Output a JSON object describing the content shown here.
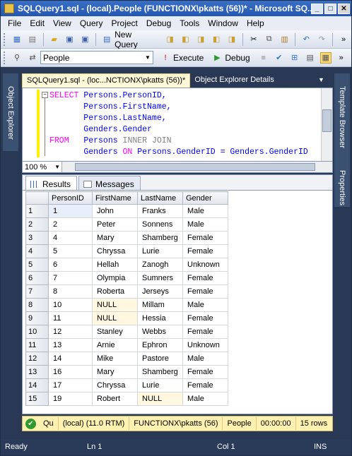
{
  "window": {
    "title": "SQLQuery1.sql - (local).People (FUNCTIONX\\pkatts (56))* - Microsoft SQ..."
  },
  "menu": [
    "File",
    "Edit",
    "View",
    "Query",
    "Project",
    "Debug",
    "Tools",
    "Window",
    "Help"
  ],
  "toolbar1": {
    "new_query_label": "New Query"
  },
  "toolbar2": {
    "database": "People",
    "execute_label": "Execute",
    "debug_label": "Debug"
  },
  "side_tabs": {
    "left": "Object Explorer",
    "right_top": "Template Browser",
    "right_bottom": "Properties"
  },
  "doc_tabs": [
    {
      "label": "SQLQuery1.sql - (loc...NCTIONX\\pkatts (56))*",
      "active": true
    },
    {
      "label": "Object Explorer Details",
      "active": false
    }
  ],
  "sql": {
    "l1": {
      "kw": "SELECT",
      "text": " Persons.PersonID,"
    },
    "l2": {
      "text": "       Persons.FirstName,"
    },
    "l3": {
      "text": "       Persons.LastName,"
    },
    "l4": {
      "text": "       Genders.Gender"
    },
    "l5": {
      "kw": "FROM",
      "pad": "   ",
      "t1": "Persons ",
      "kw2": "INNER JOIN"
    },
    "l6": {
      "pad": "       ",
      "t1": "Genders ",
      "kw": "ON",
      "t2": " Persons.GenderID = Genders.GenderID"
    }
  },
  "zoom": "100 %",
  "result_tabs": {
    "results": "Results",
    "messages": "Messages"
  },
  "grid": {
    "columns": [
      "PersonID",
      "FirstName",
      "LastName",
      "Gender"
    ],
    "rows": [
      [
        "1",
        "1",
        "John",
        "Franks",
        "Male"
      ],
      [
        "2",
        "2",
        "Peter",
        "Sonnens",
        "Male"
      ],
      [
        "3",
        "4",
        "Mary",
        "Shamberg",
        "Female"
      ],
      [
        "4",
        "5",
        "Chryssa",
        "Lurie",
        "Female"
      ],
      [
        "5",
        "6",
        "Hellah",
        "Zanogh",
        "Unknown"
      ],
      [
        "6",
        "7",
        "Olympia",
        "Sumners",
        "Female"
      ],
      [
        "7",
        "8",
        "Roberta",
        "Jerseys",
        "Female"
      ],
      [
        "8",
        "10",
        "NULL",
        "Millam",
        "Male"
      ],
      [
        "9",
        "11",
        "NULL",
        "Hessia",
        "Female"
      ],
      [
        "10",
        "12",
        "Stanley",
        "Webbs",
        "Female"
      ],
      [
        "11",
        "13",
        "Arnie",
        "Ephron",
        "Unknown"
      ],
      [
        "12",
        "14",
        "Mike",
        "Pastore",
        "Male"
      ],
      [
        "13",
        "16",
        "Mary",
        "Shamberg",
        "Female"
      ],
      [
        "14",
        "17",
        "Chryssa",
        "Lurie",
        "Female"
      ],
      [
        "15",
        "19",
        "Robert",
        "NULL",
        "Male"
      ]
    ]
  },
  "query_status": {
    "status": "Qu",
    "server": "(local) (11.0 RTM)",
    "user": "FUNCTIONX\\pkatts (56)",
    "database": "People",
    "time": "00:00:00",
    "rows": "15 rows"
  },
  "statusbar": {
    "ready": "Ready",
    "ln": "Ln 1",
    "col": "Col 1",
    "ins": "INS"
  }
}
